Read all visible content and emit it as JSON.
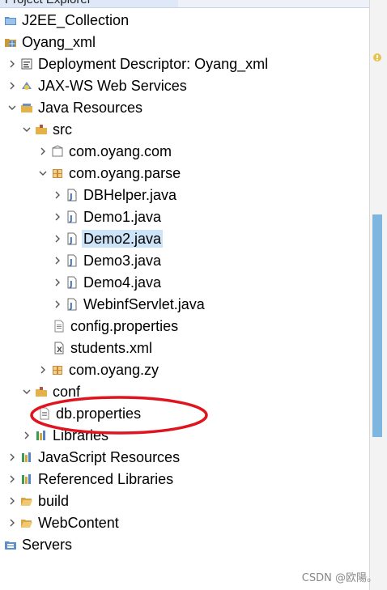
{
  "panel": {
    "title": "Project Explorer"
  },
  "tree": [
    {
      "id": "j2ee",
      "label": "J2EE_Collection",
      "icon": "folder-project-icon",
      "chev": "none"
    },
    {
      "id": "oyang",
      "label": "Oyang_xml",
      "icon": "web-project-icon",
      "chev": "none"
    },
    {
      "id": "deploy",
      "label": "Deployment Descriptor: Oyang_xml",
      "icon": "deployment-descriptor-icon",
      "chev": "right"
    },
    {
      "id": "jaxws",
      "label": "JAX-WS Web Services",
      "icon": "web-services-icon",
      "chev": "right"
    },
    {
      "id": "javares",
      "label": "Java Resources",
      "icon": "java-resources-icon",
      "chev": "down"
    },
    {
      "id": "src",
      "label": "src",
      "icon": "source-folder-icon",
      "chev": "down"
    },
    {
      "id": "pkg-com",
      "label": "com.oyang.com",
      "icon": "package-empty-icon",
      "chev": "right"
    },
    {
      "id": "pkg-parse",
      "label": "com.oyang.parse",
      "icon": "package-icon",
      "chev": "down"
    },
    {
      "id": "dbhelper",
      "label": "DBHelper.java",
      "icon": "java-file-icon",
      "chev": "right"
    },
    {
      "id": "demo1",
      "label": "Demo1.java",
      "icon": "java-file-icon",
      "chev": "right"
    },
    {
      "id": "demo2",
      "label": "Demo2.java",
      "icon": "java-file-icon",
      "chev": "right",
      "selected": true
    },
    {
      "id": "demo3",
      "label": "Demo3.java",
      "icon": "java-file-icon",
      "chev": "right"
    },
    {
      "id": "demo4",
      "label": "Demo4.java",
      "icon": "java-file-icon",
      "chev": "right"
    },
    {
      "id": "webinf",
      "label": "WebinfServlet.java",
      "icon": "java-file-icon",
      "chev": "right"
    },
    {
      "id": "config",
      "label": "config.properties",
      "icon": "text-file-icon",
      "chev": "none"
    },
    {
      "id": "students",
      "label": "students.xml",
      "icon": "xml-file-icon",
      "chev": "none"
    },
    {
      "id": "pkg-zy",
      "label": "com.oyang.zy",
      "icon": "package-icon",
      "chev": "right"
    },
    {
      "id": "conf",
      "label": "conf",
      "icon": "source-folder-icon",
      "chev": "down"
    },
    {
      "id": "dbprops",
      "label": "db.properties",
      "icon": "text-file-icon",
      "chev": "none"
    },
    {
      "id": "libs",
      "label": "Libraries",
      "icon": "library-icon",
      "chev": "right"
    },
    {
      "id": "jsres",
      "label": "JavaScript Resources",
      "icon": "library-icon",
      "chev": "right"
    },
    {
      "id": "reflibs",
      "label": "Referenced Libraries",
      "icon": "library-icon",
      "chev": "right"
    },
    {
      "id": "build",
      "label": "build",
      "icon": "folder-open-icon",
      "chev": "right"
    },
    {
      "id": "webcontent",
      "label": "WebContent",
      "icon": "folder-open-icon",
      "chev": "right"
    },
    {
      "id": "servers",
      "label": "Servers",
      "icon": "servers-project-icon",
      "chev": "none"
    }
  ],
  "watermark": "CSDN @欧陽。",
  "colors": {
    "selection": "#cde3f8",
    "annotation": "#e0141e",
    "scrollThumb": "#7fb6e0"
  }
}
